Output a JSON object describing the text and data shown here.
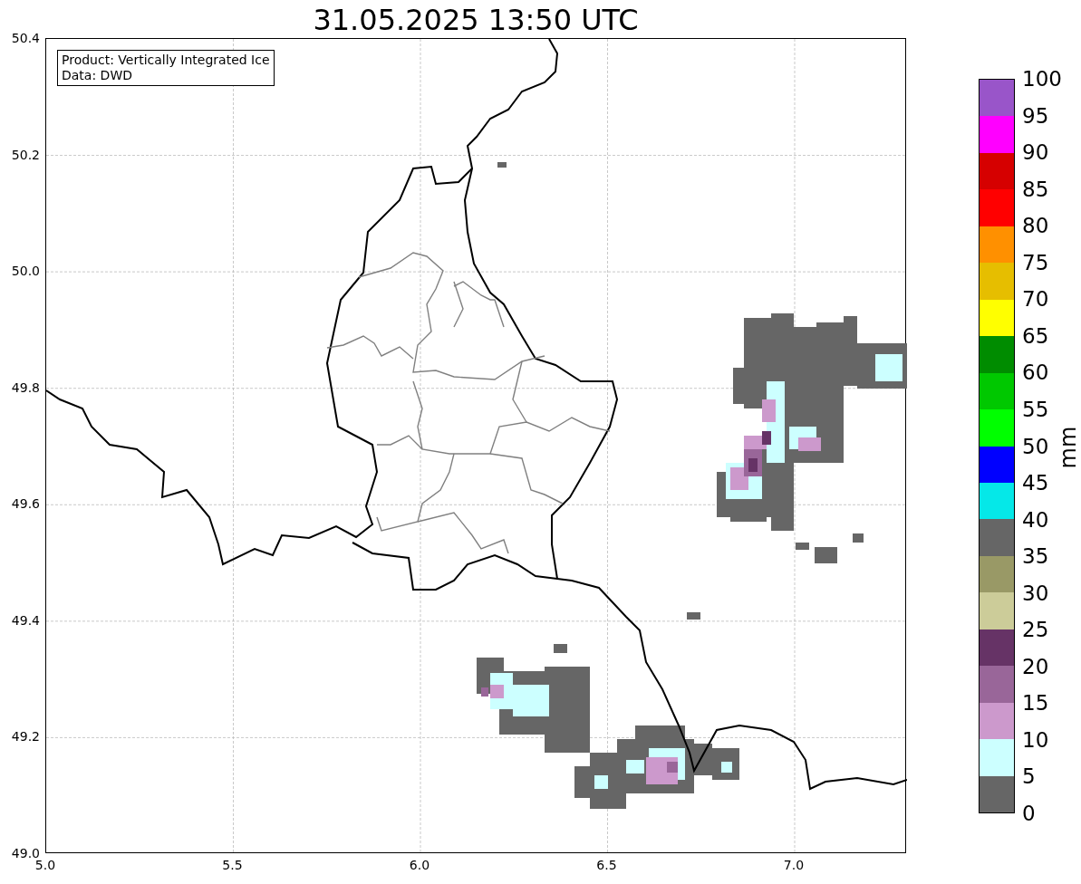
{
  "title": "31.05.2025 13:50 UTC",
  "map": {
    "legend_lines": [
      "Product: Vertically Integrated Ice",
      "Data: DWD"
    ],
    "xticks": [
      "5.0",
      "5.5",
      "6.0",
      "6.5",
      "7.0"
    ],
    "yticks": [
      "50.4",
      "50.2",
      "50.0",
      "49.8",
      "49.6",
      "49.4",
      "49.2",
      "49.0"
    ]
  },
  "colorbar": {
    "label": "mm",
    "bins": [
      {
        "color": "#9955c9"
      },
      {
        "color": "#ff00ff"
      },
      {
        "color": "#d60000"
      },
      {
        "color": "#ff0000"
      },
      {
        "color": "#ff9000"
      },
      {
        "color": "#e6be00"
      },
      {
        "color": "#ffff00"
      },
      {
        "color": "#008c00"
      },
      {
        "color": "#00c800"
      },
      {
        "color": "#00ff00"
      },
      {
        "color": "#0000ff"
      },
      {
        "color": "#05e8e8"
      },
      {
        "color": "#666666"
      },
      {
        "color": "#999966"
      },
      {
        "color": "#cccc99"
      },
      {
        "color": "#663366"
      },
      {
        "color": "#996699"
      },
      {
        "color": "#cc99cc"
      },
      {
        "color": "#ccffff"
      },
      {
        "color": "#666666"
      }
    ],
    "ticks": [
      "100",
      "95",
      "90",
      "85",
      "80",
      "75",
      "70",
      "65",
      "60",
      "55",
      "50",
      "45",
      "40",
      "35",
      "30",
      "25",
      "20",
      "15",
      "10",
      "5",
      "0"
    ]
  }
}
